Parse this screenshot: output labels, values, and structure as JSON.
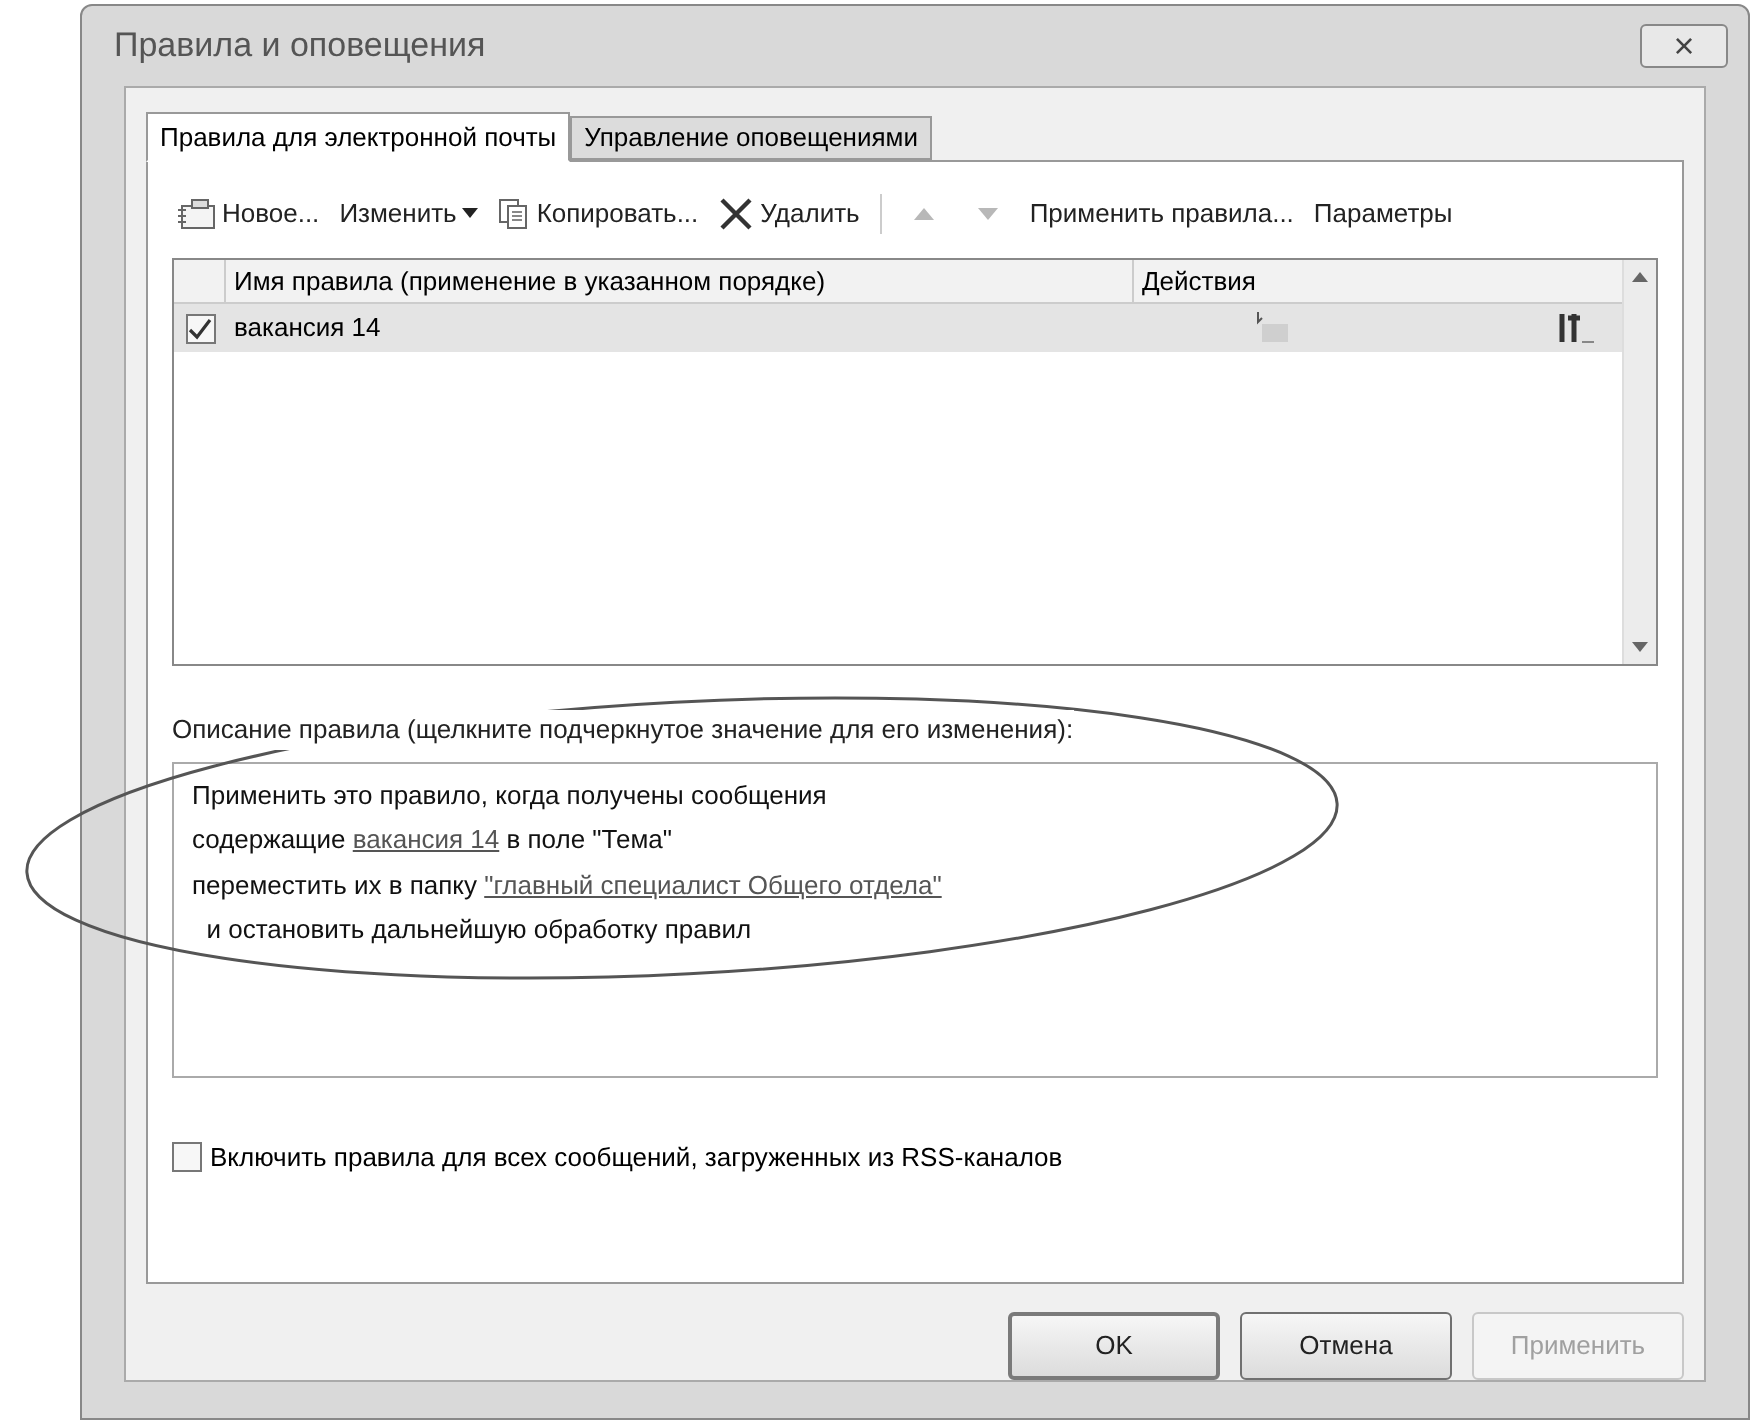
{
  "window": {
    "title": "Правила и оповещения",
    "close": "×"
  },
  "tabs": [
    {
      "label": "Правила для электронной почты",
      "selected": true
    },
    {
      "label": "Управление оповещениями",
      "selected": false
    }
  ],
  "toolbar": [
    {
      "kind": "new",
      "label": "Новое...",
      "disabled": false
    },
    {
      "kind": "dropdown",
      "label": "Изменить",
      "disabled": false
    },
    {
      "kind": "copy",
      "label": "Копировать...",
      "disabled": false
    },
    {
      "kind": "delete",
      "label": "Удалить",
      "disabled": false
    },
    {
      "kind": "separator"
    },
    {
      "kind": "up",
      "disabled": true
    },
    {
      "kind": "down",
      "disabled": true
    },
    {
      "kind": "plain",
      "label": "Применить правила...",
      "disabled": false
    },
    {
      "kind": "plain",
      "label": "Параметры",
      "disabled": false
    }
  ],
  "rules_table": {
    "columns": [
      "Имя правила (применение в указанном порядке)",
      "Действия"
    ],
    "rows": [
      {
        "checked": true,
        "selected": true,
        "name": "вакансия 14"
      }
    ]
  },
  "description": {
    "label": "Описание правила (щелкните подчеркнутое значение для его изменения):",
    "lines": [
      [
        {
          "kind": "text",
          "text": "Применить это правило, когда получены сообщения"
        }
      ],
      [
        {
          "kind": "text",
          "text": "содержащие "
        },
        {
          "kind": "link",
          "text": "вакансия 14"
        },
        {
          "kind": "text",
          "text": " в поле \"Тема\""
        }
      ],
      [
        {
          "kind": "text",
          "text": "переместить их в папку "
        },
        {
          "kind": "link",
          "text": "\"главный специалист Общего отдела\""
        }
      ],
      [
        {
          "kind": "text",
          "text": "  и остановить дальнейшую обработку правил"
        }
      ]
    ]
  },
  "rss_option": {
    "label": "Включить правила для всех сообщений, загруженных из RSS-каналов",
    "checked": false
  },
  "buttons": [
    {
      "label": "OK",
      "disabled": false,
      "default": true
    },
    {
      "label": "Отмена",
      "disabled": false,
      "default": false
    },
    {
      "label": "Применить",
      "disabled": true,
      "default": false
    }
  ]
}
